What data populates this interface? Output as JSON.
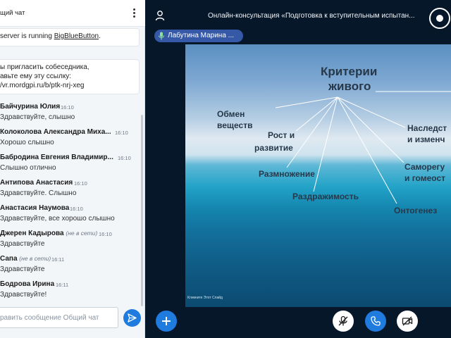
{
  "chat": {
    "title": "щий чат",
    "system_msg1_text": "server is running ",
    "system_msg1_link": "BigBlueButton",
    "system_msg1_end": ".",
    "system_msg2_line1": "ы пригласить собеседника,",
    "system_msg2_line2": "авьте ему эту ссылку:",
    "system_msg2_line3": "/vr.mordgpi.ru/b/ptk-nrj-xeg",
    "messages": [
      {
        "name": "Байчурина Юлия",
        "time": "16:10",
        "text": "Здравствуйте, слышно"
      },
      {
        "name": "Колоколова Александра Миха...",
        "time": "16:10",
        "text": "Хорошо слышно"
      },
      {
        "name": "Бабродина Евгения Владимир...",
        "time": "16:10",
        "text": "Слышно отлично"
      },
      {
        "name": "Антипова Анастасия",
        "time": "16:10",
        "text": "Здравствуйте. Слышно"
      },
      {
        "name": "Анастасия Наумова",
        "time": "16:10",
        "text": "Здравствуйте, все хорошо слышно"
      },
      {
        "name": "Джерен Кадырова",
        "offline": "(не в сети)",
        "time": "16:10",
        "text": "Здравствуйте"
      },
      {
        "name": "Сапа",
        "offline": "(не в сети)",
        "time": "16:11",
        "text": "Здравствуйте"
      },
      {
        "name": "Бодрова Ирина",
        "time": "16:11",
        "text": "Здравствуйте!"
      }
    ],
    "input_placeholder": "равить сообщение Общий чат"
  },
  "header": {
    "session_title": "Онлайн-консультация «Подготовка к вступительным испытан..."
  },
  "talker": {
    "name": "Лабутина Марина ..."
  },
  "slide": {
    "title_line1": "Критерии",
    "title_line2": "живого",
    "labels": {
      "metabolism_1": "Обмен",
      "metabolism_2": "веществ",
      "growth_1": "Рост и",
      "growth_2": "развитие",
      "reproduction": "Размножение",
      "irritability": "Раздражимость",
      "ontogenesis": "Онтогенез",
      "heredity_1": "Наследст",
      "heredity_2": "и изменч",
      "selfreg_1": "Саморегу",
      "selfreg_2": "и гомеост"
    },
    "credit": "Кликните Этот Слайд"
  },
  "colors": {
    "accent": "#1f7bde",
    "talker_badge": "#3559a6",
    "main_bg": "#06172a"
  }
}
